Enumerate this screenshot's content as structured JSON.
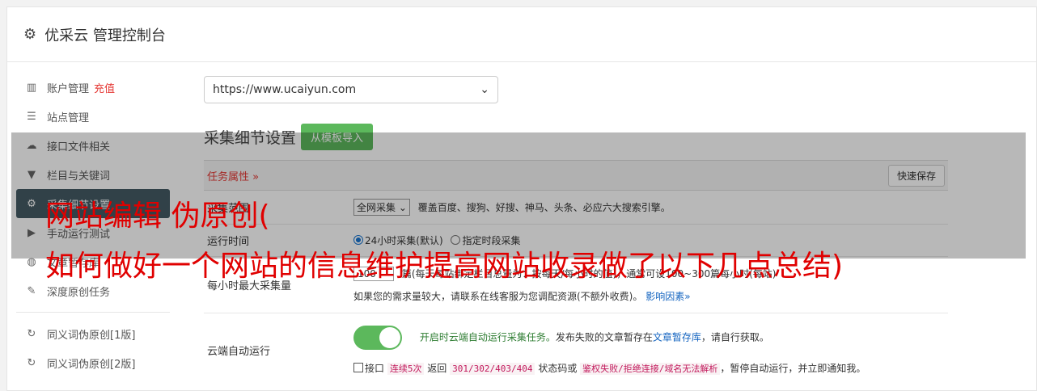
{
  "header": {
    "title": "优采云 管理控制台",
    "icon": "gear-icon"
  },
  "sidebar": {
    "items": [
      {
        "icon": "bar-chart-icon",
        "label": "账户管理",
        "extra": "充值"
      },
      {
        "icon": "server-icon",
        "label": "站点管理"
      },
      {
        "icon": "cloud-upload-icon",
        "label": "接口文件相关"
      },
      {
        "icon": "filter-icon",
        "label": "栏目与关键词"
      },
      {
        "icon": "gears-icon",
        "label": "采集细节设置"
      },
      {
        "icon": "play-circle-icon",
        "label": "手动运行测试"
      },
      {
        "icon": "database-icon",
        "label": "文章暂存库"
      },
      {
        "icon": "edit-icon",
        "label": "深度原创任务"
      },
      {
        "icon": "refresh-icon",
        "label": "同义词伪原创[1版]"
      },
      {
        "icon": "refresh-icon",
        "label": "同义词伪原创[2版]"
      }
    ]
  },
  "main": {
    "site_select": "https://www.ucaiyun.com",
    "section_title": "采集细节设置",
    "import_button": "从模板导入",
    "task_attr_label": "任务属性 »",
    "quick_save_button": "快速保存",
    "rows": {
      "collect_range": {
        "label": "采集范围",
        "select": "全网采集",
        "desc": "覆盖百度、搜狗、好搜、神马、头条、必应六大搜索引擎。"
      },
      "run_time": {
        "label": "运行时间",
        "opt1": "24小时采集(默认)",
        "opt2": "指定时段采集"
      },
      "max_per_hour": {
        "label": "每小时最大采集量",
        "value": "100",
        "desc": "篇(每天每站绑定栏目总量为：按每天/每小时的值)，通常可设100~300篇每小时(每站)",
        "note": "如果您的需求量较大，请联系在线客服为您调配资源(不额外收费)。",
        "link": "影响因素»"
      },
      "cloud_run": {
        "label": "云端自动运行",
        "desc_green": "开启时云端自动运行采集任务。",
        "desc_rest": "发布失败的文章暂存在",
        "link": "文章暂存库",
        "desc_tail": "，请自行获取。",
        "chk_label": "接口",
        "code1": "连续5次",
        "t1": "返回",
        "code2": "301/302/403/404",
        "t2": "状态码或",
        "code3": "鉴权失败/拒绝连接/域名无法解析",
        "t3": "，暂停自动运行，并立即通知我。"
      }
    }
  },
  "overlay": {
    "line1": "网站编辑 伪原创(",
    "line2": "如何做好一个网站的信息维护提高网站收录做了以下几点总结)"
  },
  "colors": {
    "accent_green": "#5cb85c",
    "sidebar_active": "#455a64",
    "warning_red": "#e53935",
    "overlay_red": "#e00000"
  }
}
